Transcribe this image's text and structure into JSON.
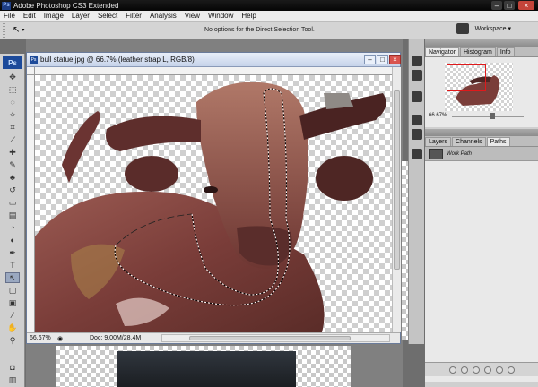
{
  "window": {
    "title": "Adobe Photoshop CS3 Extended",
    "app_badge": "Ps",
    "minimize": "–",
    "restore": "□",
    "close": "×"
  },
  "menu": [
    "File",
    "Edit",
    "Image",
    "Layer",
    "Select",
    "Filter",
    "Analysis",
    "View",
    "Window",
    "Help"
  ],
  "options_bar": {
    "tool_glyph": "↖",
    "message": "No options for the Direct Selection Tool.",
    "workspace_label": "Workspace ▾"
  },
  "toolbox": {
    "logo": "Ps"
  },
  "document": {
    "title": "bull statue.jpg @ 66.7% (leather strap L, RGB/8)",
    "zoom": "66.67%",
    "doc_info": "Doc: 9.00M/28.4M",
    "minimize": "–",
    "restore": "□",
    "close": "×"
  },
  "navigator": {
    "tabs": [
      "Navigator",
      "Histogram",
      "Info"
    ],
    "zoom": "66.67%"
  },
  "paths_panel": {
    "tabs": [
      "Layers",
      "Channels",
      "Paths"
    ],
    "items": [
      {
        "label": "Work Path"
      }
    ]
  },
  "colors": {
    "titlebar": "#0b0b0b",
    "ps_blue": "#1c4a9a",
    "selection_red": "#e0191b"
  }
}
